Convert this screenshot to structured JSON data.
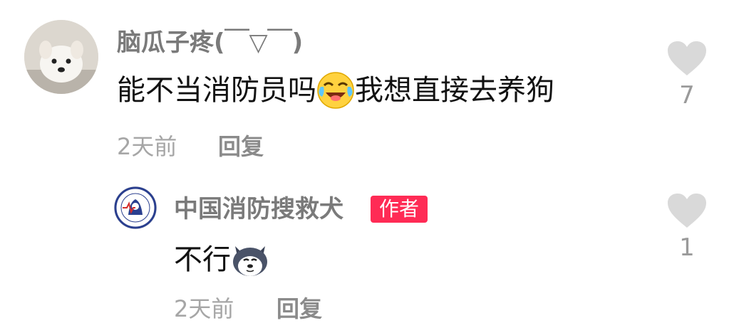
{
  "comment": {
    "username": "脑瓜子疼(￣▽￣)",
    "text_before": "能不当消防员吗",
    "emoji": "crying-laughing-emoji",
    "text_after": "我想直接去养狗",
    "time": "2天前",
    "reply_label": "回复",
    "like_count": "7"
  },
  "reply": {
    "username": "中国消防搜救犬",
    "badge": "作者",
    "text": "不行",
    "emoji": "husky-emoji",
    "time": "2天前",
    "reply_label": "回复",
    "like_count": "1"
  },
  "colors": {
    "badge": "#ff2b55",
    "heart": "#d9d9d9",
    "username": "#7a7a7a",
    "meta": "#a6a6a6"
  }
}
